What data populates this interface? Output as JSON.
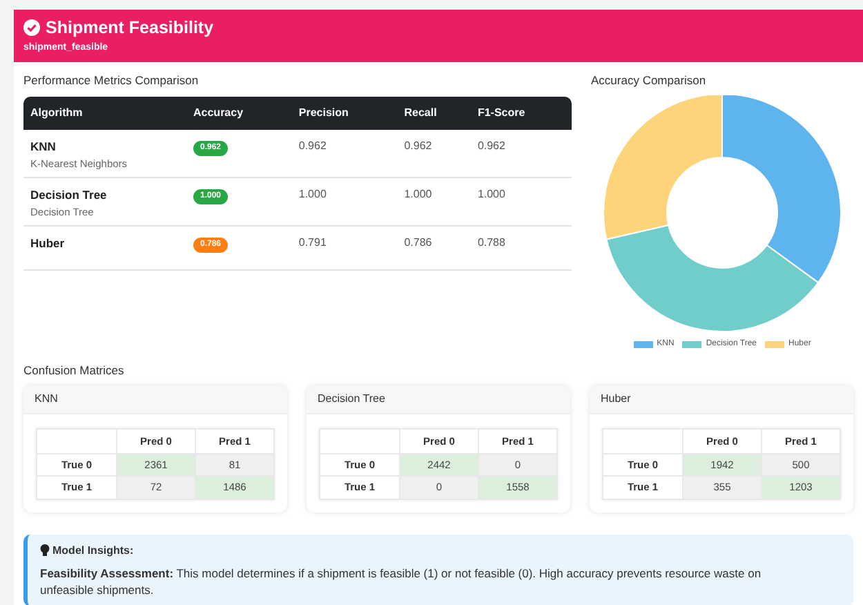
{
  "header": {
    "title": "Shipment Feasibility",
    "subtitle": "shipment_feasible"
  },
  "metrics": {
    "title": "Performance Metrics Comparison",
    "columns": [
      "Algorithm",
      "Accuracy",
      "Precision",
      "Recall",
      "F1-Score"
    ],
    "rows": [
      {
        "name": "KNN",
        "description": "K-Nearest Neighbors",
        "accuracy": "0.962",
        "color": "#28a745",
        "precision": "0.962",
        "recall": "0.962",
        "f1": "0.962"
      },
      {
        "name": "Decision Tree",
        "description": "Decision Tree",
        "accuracy": "1.000",
        "color": "#28a745",
        "precision": "1.000",
        "recall": "1.000",
        "f1": "1.000"
      },
      {
        "name": "Huber",
        "accuracy": "0.786",
        "color": "#fd7e14",
        "precision": "0.791",
        "recall": "0.786",
        "f1": "0.788"
      }
    ]
  },
  "accuracy_chart": {
    "title": "Accuracy Comparison",
    "chart_data": {
      "type": "donut",
      "categories": [
        "KNN",
        "Decision Tree",
        "Huber"
      ],
      "values": [
        35.0,
        36.4,
        28.6
      ]
    },
    "legend": [
      {
        "color": "#5eb4ec"
      },
      {
        "color": "#70cdca"
      },
      {
        "color": "#fdd47a"
      }
    ]
  },
  "confusion": {
    "title": "Confusion Matrices",
    "matrices": [
      {
        "name": "KNN",
        "columns": [
          "Pred 0",
          "Pred 1"
        ],
        "rows": [
          {
            "label": "True 0",
            "cells": [
              {
                "value": "2361",
                "correct": true
              },
              {
                "value": "81",
                "correct": false
              }
            ]
          },
          {
            "label": "True 1",
            "cells": [
              {
                "value": "72",
                "correct": false
              },
              {
                "value": "1486",
                "correct": true
              }
            ]
          }
        ]
      },
      {
        "name": "Decision Tree",
        "columns": [
          "Pred 0",
          "Pred 1"
        ],
        "rows": [
          {
            "label": "True 0",
            "cells": [
              {
                "value": "2442",
                "correct": true
              },
              {
                "value": "0",
                "correct": false
              }
            ]
          },
          {
            "label": "True 1",
            "cells": [
              {
                "value": "0",
                "correct": false
              },
              {
                "value": "1558",
                "correct": true
              }
            ]
          }
        ]
      },
      {
        "name": "Huber",
        "columns": [
          "Pred 0",
          "Pred 1"
        ],
        "rows": [
          {
            "label": "True 0",
            "cells": [
              {
                "value": "1942",
                "correct": true
              },
              {
                "value": "500",
                "correct": false
              }
            ]
          },
          {
            "label": "True 1",
            "cells": [
              {
                "value": "355",
                "correct": false
              },
              {
                "value": "1203",
                "correct": true
              }
            ]
          }
        ]
      }
    ]
  },
  "insights": {
    "title": "Model Insights:",
    "text": "**Feasibility Assessment:** This model determines if a shipment is feasible (1) or not feasible (0). High accuracy prevents resource waste on unfeasible shipments."
  }
}
